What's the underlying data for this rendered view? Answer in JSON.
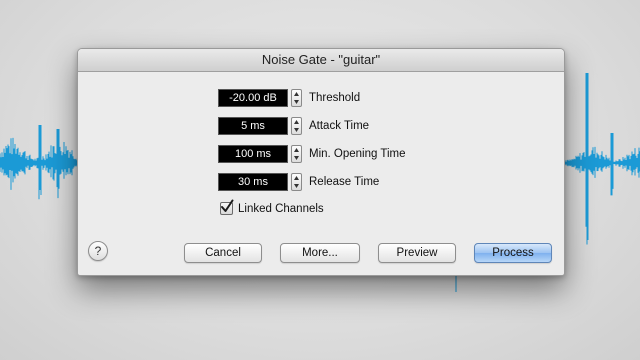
{
  "dialog": {
    "title": "Noise Gate - \"guitar\""
  },
  "parameters": [
    {
      "value": "-20.00 dB",
      "label": "Threshold"
    },
    {
      "value": "5 ms",
      "label": "Attack Time"
    },
    {
      "value": "100 ms",
      "label": "Min. Opening Time"
    },
    {
      "value": "30 ms",
      "label": "Release Time"
    }
  ],
  "linked_channels": {
    "label": "Linked Channels",
    "checked": true
  },
  "buttons": {
    "help": "?",
    "cancel": "Cancel",
    "more": "More...",
    "preview": "Preview",
    "process": "Process"
  },
  "colors": {
    "waveform": "#1b9ad6",
    "default_button": "#8dbbf0"
  },
  "icons": [
    "stepper-arrows-icon",
    "checkmark-icon",
    "help-icon"
  ]
}
